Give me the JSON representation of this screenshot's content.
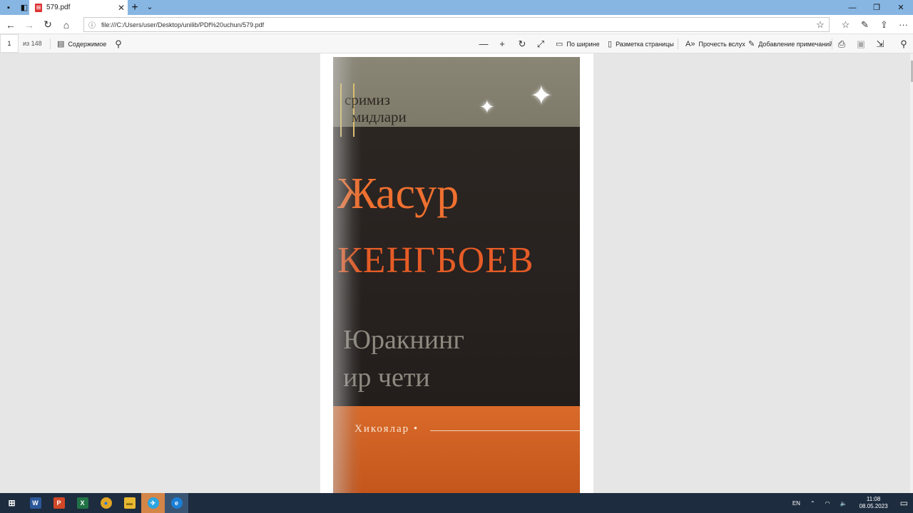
{
  "browser": {
    "tab_title": "579.pdf",
    "url": "file:///C:/Users/user/Desktop/unilib/PDf%20uchun/579.pdf"
  },
  "icons": {
    "tab_actions": "tab-actions-icon",
    "tabs_aside": "tabs-aside-icon",
    "pdf": "pdf-icon",
    "close": "close-icon",
    "new_tab": "plus-icon",
    "tab_list": "chevron-down-icon",
    "minimize": "minimize-icon",
    "restore": "restore-icon",
    "window_close": "close-icon",
    "back": "back-arrow-icon",
    "forward": "forward-arrow-icon",
    "refresh": "refresh-icon",
    "home": "home-icon",
    "info": "info-icon",
    "favorite": "star-icon",
    "favorites": "favorites-icon",
    "notes": "pen-icon",
    "share": "share-icon",
    "more": "more-icon"
  },
  "pdf_toolbar": {
    "page_number": "1",
    "page_count": "из 148",
    "contents": "Содержимое",
    "fit_width": "По ширине",
    "page_layout": "Разметка страницы",
    "read_aloud": "Прочесть вслух",
    "add_notes": "Добавление примечаний"
  },
  "cover": {
    "series_line1": "сримиз",
    "series_line2": "мидлари",
    "author_first": "Жасур",
    "author_last": "КЕНГБОЕВ",
    "title_line1": "Юракнинг",
    "title_line2": "ир чети",
    "subtitle": "Хикоялар •"
  },
  "taskbar": {
    "apps": [
      {
        "name": "word",
        "label": "W",
        "color": "#2b579a"
      },
      {
        "name": "powerpoint",
        "label": "P",
        "color": "#d24726"
      },
      {
        "name": "excel",
        "label": "X",
        "color": "#217346"
      },
      {
        "name": "chrome",
        "label": "●",
        "color": "#e0a526"
      },
      {
        "name": "explorer",
        "label": "▬",
        "color": "#e8b931"
      },
      {
        "name": "telegram",
        "label": "✈",
        "color": "#2ca5e0"
      },
      {
        "name": "edge",
        "label": "e",
        "color": "#1b7fd6"
      }
    ],
    "language": "EN",
    "time": "11:08",
    "date": "08.05.2023"
  }
}
